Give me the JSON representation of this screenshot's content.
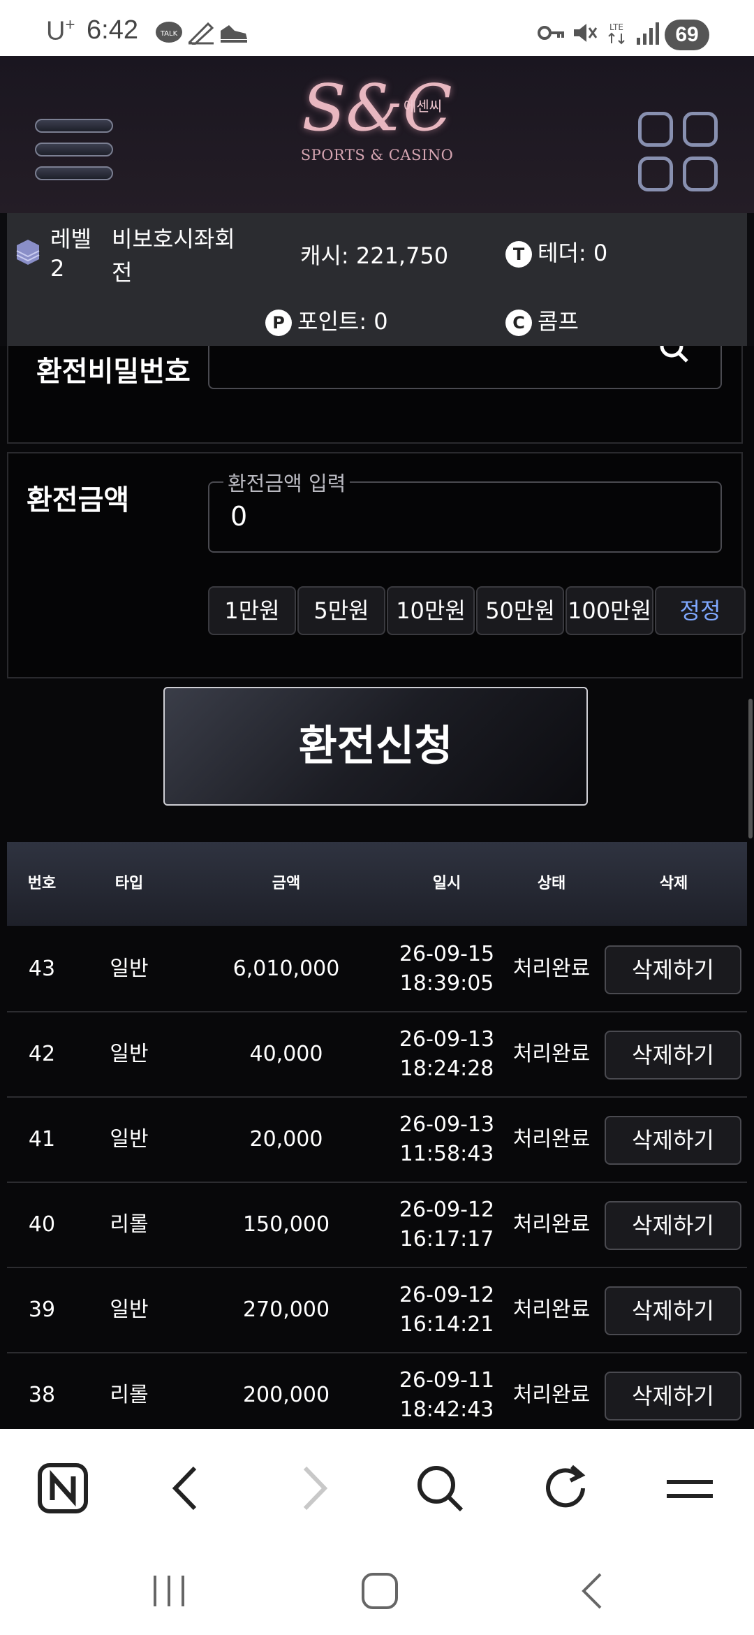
{
  "status_bar": {
    "carrier": "U",
    "carrier_sup": "+",
    "time": "6:42",
    "battery": "69",
    "icons": [
      "talk-icon",
      "pen-icon",
      "shoe-icon",
      "key-icon",
      "mute-icon",
      "lte-icon",
      "signal-icon"
    ]
  },
  "header": {
    "logo_mark": "S&C",
    "logo_korean": "에센씨",
    "logo_sub": "SPORTS & CASINO"
  },
  "info": {
    "level_label": "레벨",
    "level_value": "2",
    "username_line1": "비보호시좌회",
    "username_line2": "전",
    "cash": "캐시: 221,750",
    "tether_icon": "T",
    "tether": "테더: 0",
    "point_icon": "P",
    "point": "포인트: 0",
    "comp_icon": "C",
    "comp": "콤프"
  },
  "form": {
    "password_label": "환전비밀번호",
    "amount_label": "환전금액",
    "amount_legend": "환전금액 입력",
    "amount_value": "0",
    "quick_buttons": [
      "1만원",
      "5만원",
      "10만원",
      "50만원",
      "100만원",
      "정정"
    ],
    "submit_label": "환전신청"
  },
  "table": {
    "headers": [
      "번호",
      "타입",
      "금액",
      "일시",
      "상태",
      "삭제"
    ],
    "rows": [
      {
        "no": "43",
        "type": "일반",
        "amount": "6,010,000",
        "date": "26-09-15",
        "time": "18:39:05",
        "status": "처리완료",
        "action": "삭제하기"
      },
      {
        "no": "42",
        "type": "일반",
        "amount": "40,000",
        "date": "26-09-13",
        "time": "18:24:28",
        "status": "처리완료",
        "action": "삭제하기"
      },
      {
        "no": "41",
        "type": "일반",
        "amount": "20,000",
        "date": "26-09-13",
        "time": "11:58:43",
        "status": "처리완료",
        "action": "삭제하기"
      },
      {
        "no": "40",
        "type": "리롤",
        "amount": "150,000",
        "date": "26-09-12",
        "time": "16:17:17",
        "status": "처리완료",
        "action": "삭제하기"
      },
      {
        "no": "39",
        "type": "일반",
        "amount": "270,000",
        "date": "26-09-12",
        "time": "16:14:21",
        "status": "처리완료",
        "action": "삭제하기"
      },
      {
        "no": "38",
        "type": "리롤",
        "amount": "200,000",
        "date": "26-09-11",
        "time": "18:42:43",
        "status": "처리완료",
        "action": "삭제하기"
      }
    ]
  },
  "browser_toolbar": {
    "icons": [
      "naver-home-icon",
      "back-icon",
      "forward-icon",
      "search-icon",
      "refresh-icon",
      "menu-icon"
    ]
  },
  "nav_bar": {
    "icons": [
      "recent-apps-icon",
      "home-icon",
      "back-nav-icon"
    ]
  },
  "colors": {
    "background": "#08080a",
    "info_bar": "#2b2c30",
    "table_header": "#2f3340",
    "accent_blue": "#7fa8ff",
    "logo_pink": "#e8b7c0"
  }
}
